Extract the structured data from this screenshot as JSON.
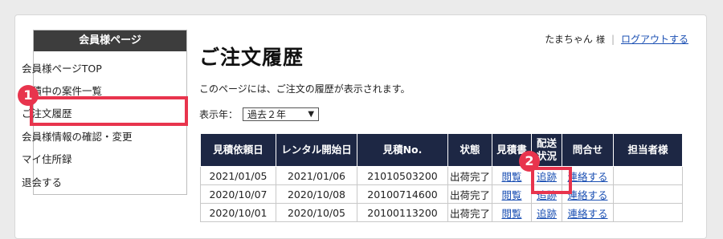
{
  "sidebar": {
    "title": "会員様ページ",
    "items": [
      {
        "label": "会員様ページTOP"
      },
      {
        "label": "見積中の案件一覧"
      },
      {
        "label": "ご注文履歴"
      },
      {
        "label": "会員様情報の確認・変更"
      },
      {
        "label": "マイ住所録"
      },
      {
        "label": "退会する"
      }
    ]
  },
  "annotations": {
    "badge1": "1",
    "badge2": "2",
    "accent": "#e8344d"
  },
  "user": {
    "name": "たまちゃん",
    "honorific": "様",
    "separator": "|",
    "logout_label": "ログアウトする"
  },
  "page": {
    "title": "ご注文履歴",
    "description": "このページには、ご注文の履歴が表示されます。",
    "year_label": "表示年：",
    "year_value": "過去２年"
  },
  "table": {
    "headers": [
      "見積依頼日",
      "レンタル開始日",
      "見積No.",
      "状態",
      "見積書",
      "配送\n状況",
      "問合せ",
      "担当者様"
    ],
    "rows": [
      [
        "2021/01/05",
        "2021/01/06",
        "21010503200",
        "出荷完了",
        "閲覧",
        "追跡",
        "連絡する",
        ""
      ],
      [
        "2020/10/07",
        "2020/10/08",
        "20100714600",
        "出荷完了",
        "閲覧",
        "追跡",
        "連絡する",
        ""
      ],
      [
        "2020/10/01",
        "2020/10/05",
        "20100113200",
        "出荷完了",
        "閲覧",
        "追跡",
        "連絡する",
        ""
      ]
    ],
    "header_color": "#1d2744",
    "link_color": "#1a4fb3"
  }
}
